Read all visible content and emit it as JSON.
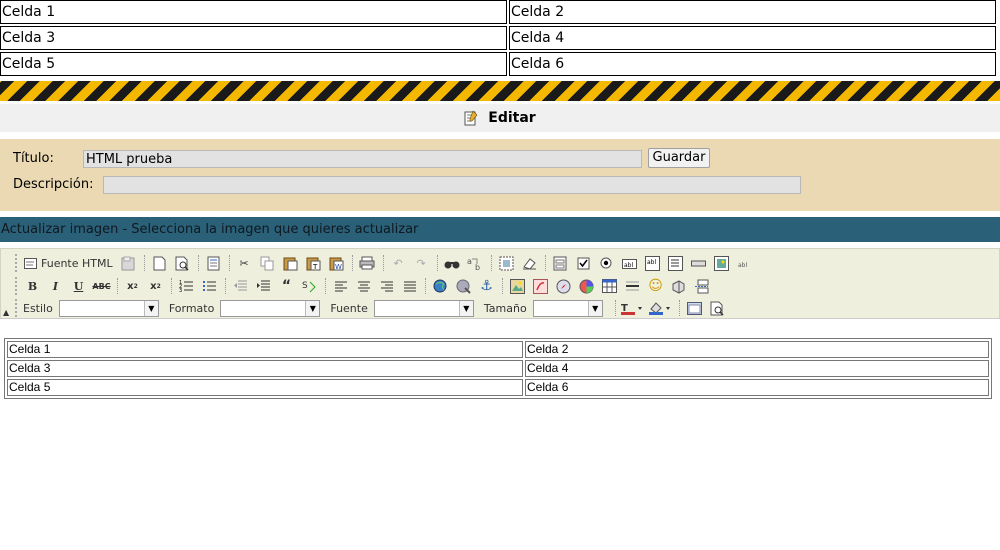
{
  "top_table": {
    "rows": [
      [
        "Celda 1",
        "Celda 2"
      ],
      [
        "Celda 3",
        "Celda 4"
      ],
      [
        "Celda 5",
        "Celda 6"
      ]
    ]
  },
  "edit_bar": {
    "label": "Editar"
  },
  "form": {
    "titulo_label": "Título:",
    "titulo_value": "HTML prueba",
    "descripcion_label": "Descripción:",
    "descripcion_value": "",
    "save_button": "Guardar"
  },
  "update_bar": {
    "text": "Actualizar imagen - Selecciona la imagen que quieres actualizar"
  },
  "toolbar": {
    "source_label": "Fuente HTML",
    "style_label": "Estilo",
    "format_label": "Formato",
    "font_label": "Fuente",
    "size_label": "Tamaño",
    "style_value": "",
    "format_value": "",
    "font_value": "",
    "size_value": ""
  },
  "editor_table": {
    "rows": [
      [
        "Celda 1",
        "Celda 2"
      ],
      [
        "Celda 3",
        "Celda 4"
      ],
      [
        "Celda 5",
        "Celda 6"
      ]
    ]
  },
  "colors": {
    "hazard_yellow": "#f5b800",
    "header_teal": "#2a6178",
    "form_bg": "#ead9b3",
    "toolbar_bg": "#efefde"
  }
}
